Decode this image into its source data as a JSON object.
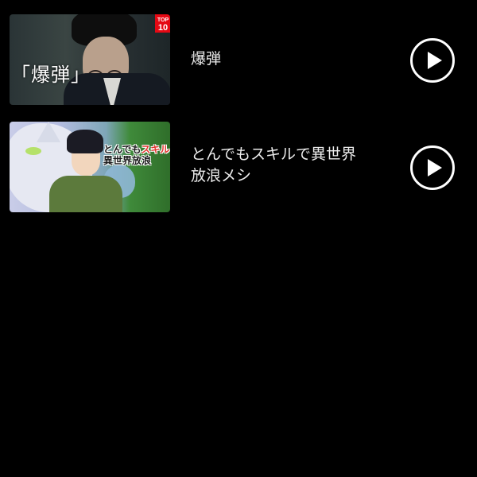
{
  "items": [
    {
      "title": "爆弾",
      "thumbnail_caption": "「爆弾」",
      "badge": {
        "line1": "TOP",
        "line2": "10"
      }
    },
    {
      "title_lines": [
        "とんでもスキルで異世界",
        "放浪メシ"
      ],
      "thumbnail_logo": {
        "line1_a": "とんでも",
        "line1_b": "スキル",
        "line2": "異世界放浪"
      }
    }
  ],
  "colors": {
    "background": "#000000",
    "text": "#ececec",
    "badge": "#e50914",
    "play_icon": "#ffffff"
  },
  "icons": {
    "play": "play-circle-icon"
  }
}
